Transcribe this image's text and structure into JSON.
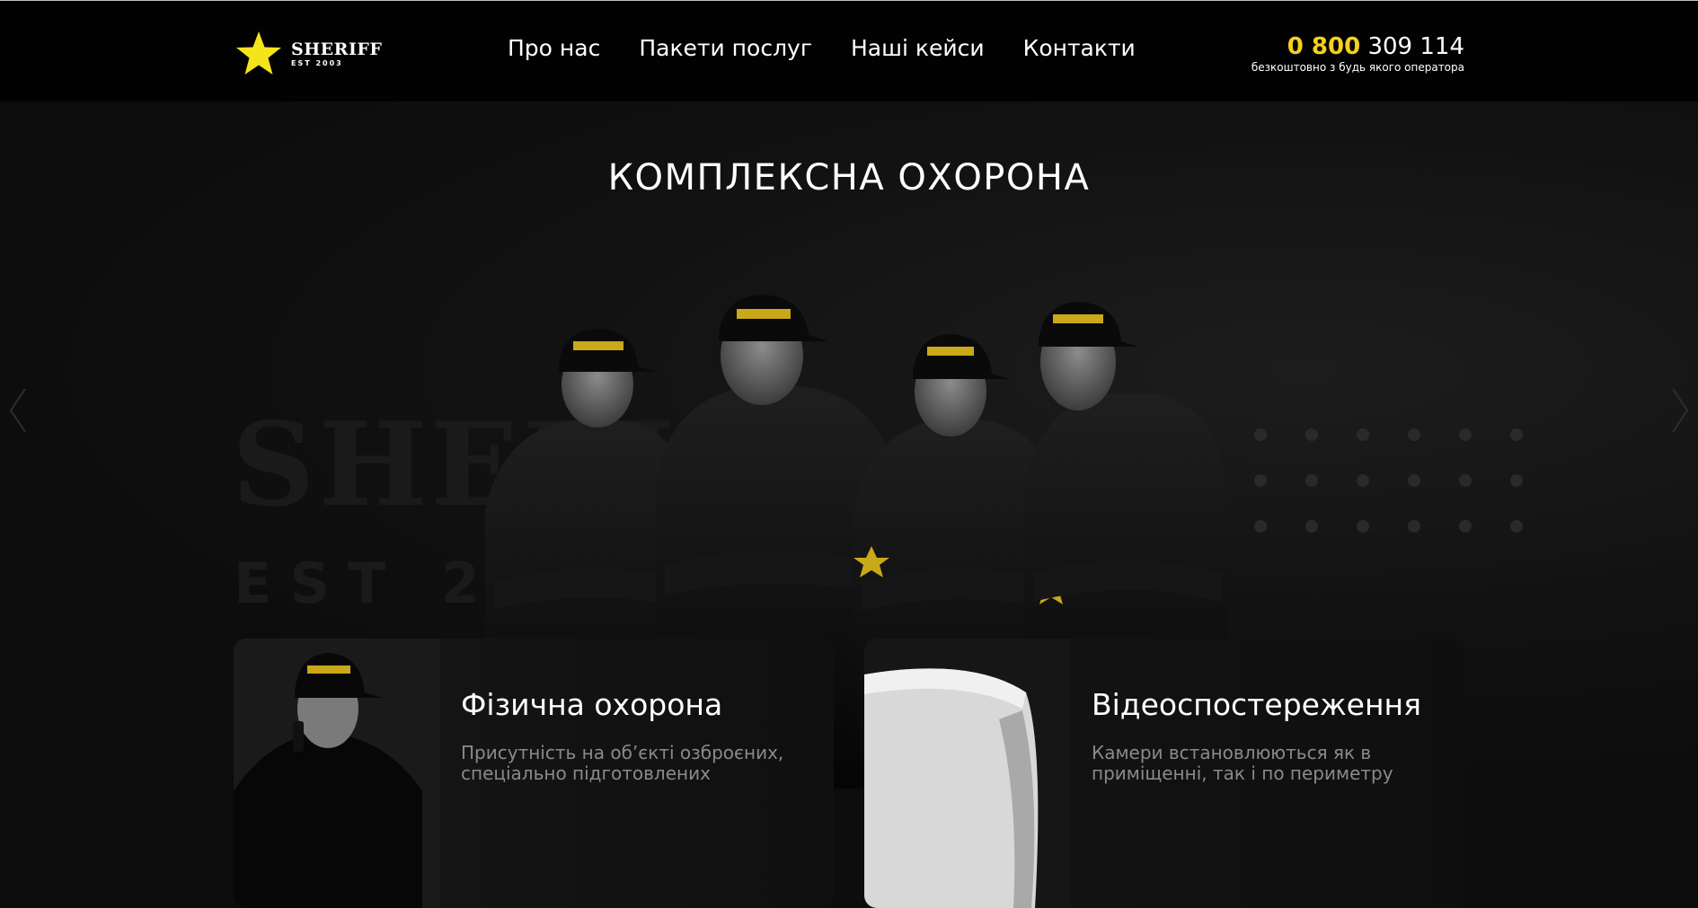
{
  "header": {
    "logo": {
      "name": "SHERIFF",
      "est": "EST 2003",
      "icon": "star-icon"
    },
    "nav": [
      {
        "label": "Про нас"
      },
      {
        "label": "Пакети послуг"
      },
      {
        "label": "Наші кейси"
      },
      {
        "label": "Контакти"
      }
    ],
    "phone": {
      "highlight": "0 800",
      "rest": "309 114",
      "note": "безкоштовно з будь якого оператора"
    }
  },
  "hero": {
    "title": "КОМПЛЕКСНА ОХОРОНА",
    "watermark_name": "SHERIFF",
    "watermark_est": "EST 2003",
    "prev_icon": "chevron-left-icon",
    "next_icon": "chevron-right-icon"
  },
  "cards": [
    {
      "title": "Фізична охорона",
      "text": "Присутність на об’єкті озброєних, спеціально підготовлених"
    },
    {
      "title": "Відеоспостереження",
      "text": "Камери встановлюються як в приміщенні, так і по периметру"
    }
  ],
  "colors": {
    "accent": "#f5d11b",
    "header_bg": "#020202",
    "hero_bg": "#0d0d0d",
    "muted_text": "#8a8a8a"
  }
}
